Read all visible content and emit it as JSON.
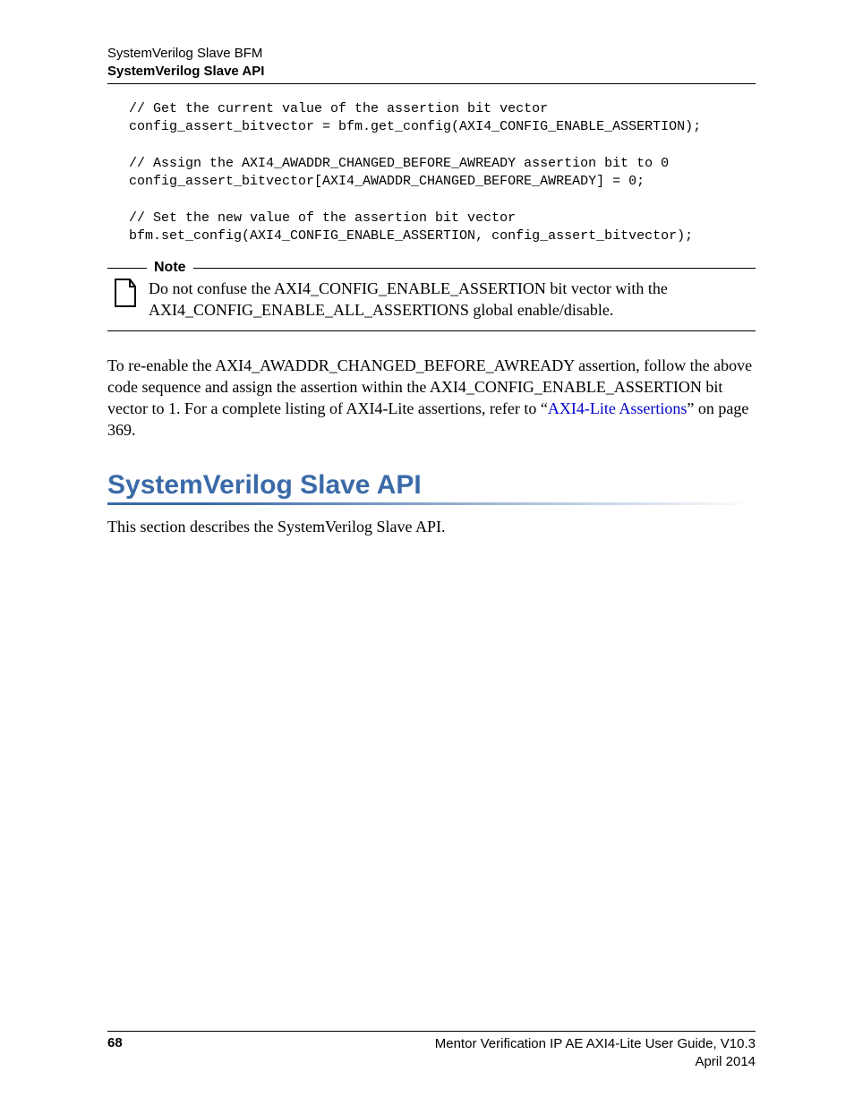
{
  "header": {
    "line1": "SystemVerilog Slave BFM",
    "line2": "SystemVerilog Slave API"
  },
  "code": {
    "c1": "// Get the current value of the assertion bit vector",
    "c2": "config_assert_bitvector = bfm.get_config(AXI4_CONFIG_ENABLE_ASSERTION);",
    "c3": "// Assign the AXI4_AWADDR_CHANGED_BEFORE_AWREADY assertion bit to 0",
    "c4": "config_assert_bitvector[AXI4_AWADDR_CHANGED_BEFORE_AWREADY] = 0;",
    "c5": "// Set the new value of the assertion bit vector",
    "c6": "bfm.set_config(AXI4_CONFIG_ENABLE_ASSERTION, config_assert_bitvector);"
  },
  "note": {
    "label": "Note",
    "text": "Do not confuse the AXI4_CONFIG_ENABLE_ASSERTION bit vector with the AXI4_CONFIG_ENABLE_ALL_ASSERTIONS global enable/disable."
  },
  "para": {
    "pre": "To re-enable the AXI4_AWADDR_CHANGED_BEFORE_AWREADY assertion, follow the above code sequence and assign the assertion within the AXI4_CONFIG_ENABLE_ASSERTION bit vector to 1. For a complete listing of AXI4-Lite assertions, refer to “",
    "link": "AXI4-Lite Assertions",
    "post": "” on page 369."
  },
  "section": {
    "heading": "SystemVerilog Slave API",
    "intro": "This section describes the SystemVerilog Slave API."
  },
  "footer": {
    "page": "68",
    "title": "Mentor Verification IP AE AXI4-Lite User Guide, V10.3",
    "date": "April 2014"
  }
}
